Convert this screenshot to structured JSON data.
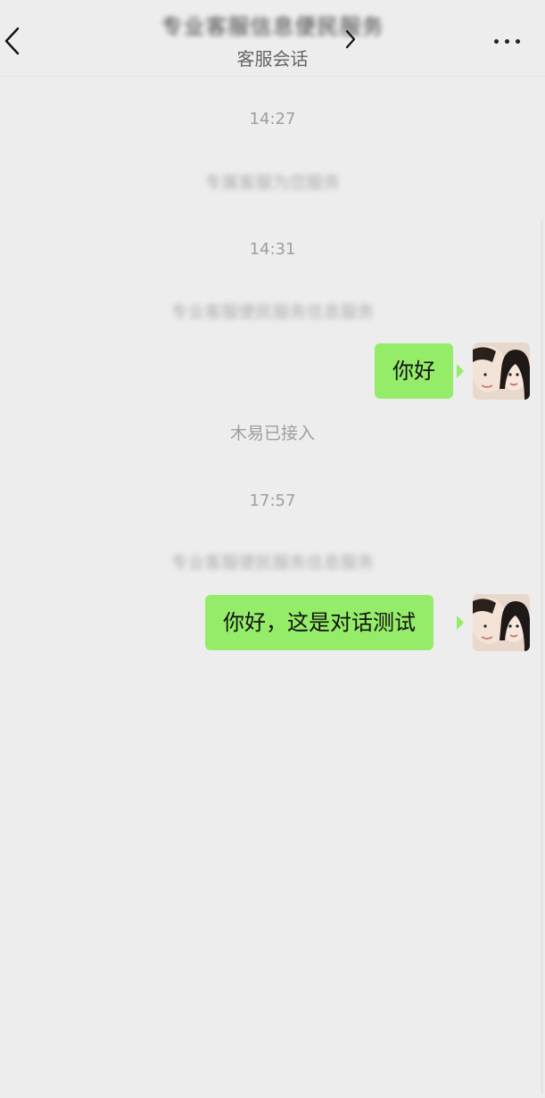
{
  "header": {
    "title": "专业客服信息便民服务",
    "subtitle": "客服会话"
  },
  "messages": {
    "time1": "14:27",
    "notice1": "专属客服为您服务",
    "time2": "14:31",
    "notice2": "专业客服便民服务信息服务",
    "chat1": "你好",
    "joined": "木易已接入",
    "time3": "17:57",
    "notice3": "专业客服便民服务信息服务",
    "chat2": "你好，这是对话测试"
  },
  "colors": {
    "background": "#ededed",
    "bubble": "#95ec69",
    "system_text": "#9e9e9e"
  },
  "icons": {
    "back": "chevron-left-icon",
    "title_arrow": "chevron-right-icon",
    "more": "more-dots-icon"
  }
}
